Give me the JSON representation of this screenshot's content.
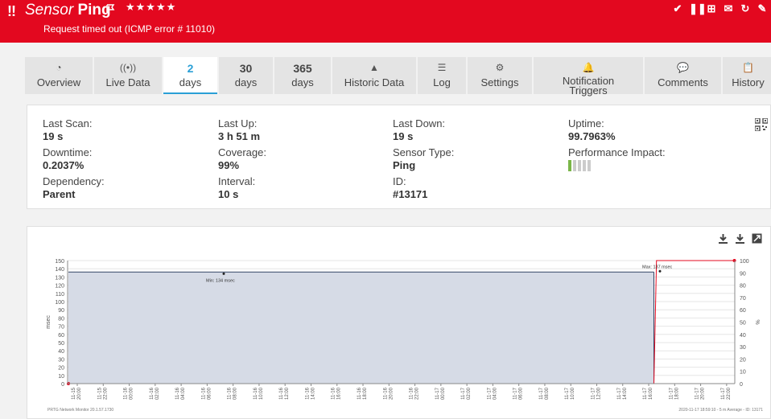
{
  "header": {
    "alert_mark": "!!",
    "title_prefix": "Sensor",
    "title_name": "Ping",
    "stars": "★★★★★",
    "status": "Request timed out (ICMP error # 11010)",
    "colors": {
      "bar": "#e3081f",
      "accent": "#2a9fd6"
    },
    "icons": [
      "check-icon",
      "pause-icon",
      "add-icon",
      "email-icon",
      "refresh-icon",
      "wrench-icon"
    ]
  },
  "tabs": [
    {
      "icon": "◔",
      "label": "Overview"
    },
    {
      "icon": "((•))",
      "label": "Live Data"
    },
    {
      "num": "2",
      "label": "days",
      "active": true
    },
    {
      "num": "30",
      "label": "days"
    },
    {
      "num": "365",
      "label": "days"
    },
    {
      "icon": "▲",
      "label": "Historic Data"
    },
    {
      "icon": "☰",
      "label": "Log"
    },
    {
      "icon": "⚙",
      "label": "Settings"
    },
    {
      "icon": "🔔",
      "label": "Notification Triggers"
    },
    {
      "icon": "💬",
      "label": "Comments"
    },
    {
      "icon": "📋",
      "label": "History"
    }
  ],
  "details": {
    "last_scan": {
      "k": "Last Scan:",
      "v": "19 s"
    },
    "downtime": {
      "k": "Downtime:",
      "v": "0.2037%"
    },
    "dependency": {
      "k": "Dependency:",
      "v": "Parent"
    },
    "last_up": {
      "k": "Last Up:",
      "v": "3 h 51 m"
    },
    "coverage": {
      "k": "Coverage:",
      "v": "99%"
    },
    "interval": {
      "k": "Interval:",
      "v": "10 s"
    },
    "last_down": {
      "k": "Last Down:",
      "v": "19 s"
    },
    "sensor_type": {
      "k": "Sensor Type:",
      "v": "Ping"
    },
    "id": {
      "k": "ID:",
      "v": "#13171"
    },
    "uptime": {
      "k": "Uptime:",
      "v": "99.7963%"
    },
    "performance_impact": {
      "k": "Performance Impact:",
      "level": 1,
      "of": 5
    }
  },
  "chart_data": {
    "type": "area",
    "ylabel_left": "msec",
    "ylabel_right": "%",
    "yticks_left": [
      0,
      10,
      20,
      30,
      40,
      50,
      60,
      70,
      80,
      90,
      100,
      110,
      120,
      130,
      140,
      150
    ],
    "yticks_right": [
      0,
      10,
      20,
      30,
      40,
      50,
      60,
      70,
      80,
      90,
      100
    ],
    "ylim_left": [
      0,
      150
    ],
    "ylim_right": [
      0,
      100
    ],
    "x_dates": [
      "11-15",
      "11-15",
      "11-16",
      "11-16",
      "11-16",
      "11-16",
      "11-16",
      "11-16",
      "11-16",
      "11-16",
      "11-16",
      "11-16",
      "11-16",
      "11-16",
      "11-17",
      "11-17",
      "11-17",
      "11-17",
      "11-17",
      "11-17",
      "11-17",
      "11-17",
      "11-17",
      "11-17",
      "11-17",
      "11-17"
    ],
    "x_times": [
      "20:00",
      "22:00",
      "00:00",
      "02:00",
      "04:00",
      "06:00",
      "08:00",
      "10:00",
      "12:00",
      "14:00",
      "16:00",
      "18:00",
      "20:00",
      "22:00",
      "00:00",
      "02:00",
      "04:00",
      "06:00",
      "08:00",
      "10:00",
      "12:00",
      "14:00",
      "16:00",
      "18:00",
      "20:00",
      "22:00"
    ],
    "series": [
      {
        "name": "",
        "axis": "left",
        "color": "#334466",
        "fill": "#d6dbe6",
        "start_x": 0,
        "end_x": 22.2,
        "value": 136
      },
      {
        "name": "",
        "axis": "right",
        "color": "#e3081f",
        "segments": [
          [
            0,
            0
          ],
          [
            22.2,
            0
          ],
          [
            22.3,
            100
          ],
          [
            25.3,
            100
          ]
        ]
      }
    ],
    "annotations": {
      "min": "Min: 134 msec",
      "max": "Max: 137 msec"
    },
    "footer_left": "PRTG Network Monitor 20.1.57.1730",
    "footer_right": "2020-11-17 18:59:10 - 5 m Average - ID: 13171"
  }
}
